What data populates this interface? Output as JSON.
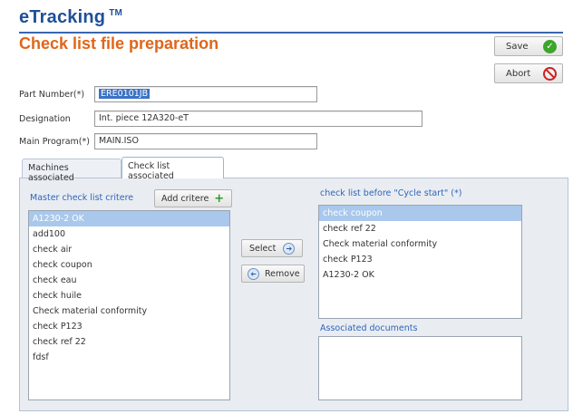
{
  "app": {
    "title": "eTracking",
    "trademark": "TM"
  },
  "page": {
    "title": "Check list file preparation"
  },
  "actions": {
    "save_label": "Save",
    "abort_label": "Abort"
  },
  "form": {
    "part_number": {
      "label": "Part Number(*)",
      "value": "ERE0101JB"
    },
    "designation": {
      "label": "Designation",
      "value": "Int. piece 12A320-eT"
    },
    "main_program": {
      "label": "Main Program(*)",
      "value": "MAIN.ISO"
    }
  },
  "tabs": [
    {
      "label": "Machines associated",
      "active": false
    },
    {
      "label": "Check list associated",
      "active": true
    }
  ],
  "master": {
    "label": "Master check list critere",
    "add_label": "Add critere",
    "selected_index": 0,
    "items": [
      "A1230-2 OK",
      "add100",
      "check air",
      "check coupon",
      "check eau",
      "check huile",
      "Check material conformity",
      "check P123",
      "check ref 22",
      "fdsf"
    ]
  },
  "transfer": {
    "select_label": "Select",
    "remove_label": "Remove"
  },
  "before_cycle": {
    "label": "check list before \"Cycle start\" (*)",
    "selected_index": 0,
    "items": [
      "check coupon",
      "check ref 22",
      "Check material conformity",
      "check P123",
      "A1230-2 OK"
    ]
  },
  "documents": {
    "label": "Associated documents",
    "items": []
  },
  "colors": {
    "brand_blue": "#1f4f9a",
    "title_orange": "#e0661a",
    "selection": "#a9c8ec",
    "save_green": "#3da62b",
    "abort_red": "#d02020"
  }
}
